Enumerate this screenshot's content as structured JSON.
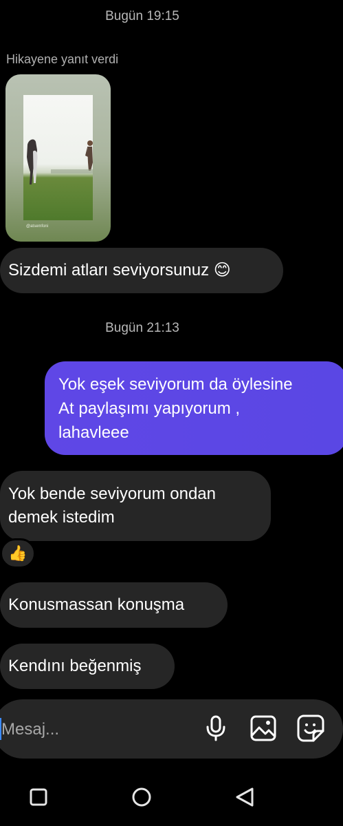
{
  "timestamps": [
    "Bugün 19:15",
    "Bugün 21:13"
  ],
  "story_reply": {
    "label": "Hikayene yanıt verdi",
    "brand_text": "@atsemfoni"
  },
  "messages": {
    "m1": "Sizdemi atları seviyorsunuz 😊",
    "sent_lines": [
      "Yok eşek seviyorum da öylesine",
      "At paylaşımı yapıyorum ,",
      "lahavleee"
    ],
    "m2_lines": [
      "Yok bende seviyorum  ondan",
      "demek istedim"
    ],
    "reaction": "👍",
    "m3": "Konusmassan konuşma",
    "m4": "Kendını beğenmiş"
  },
  "composer": {
    "placeholder": "Mesaj...",
    "icons": [
      "microphone-icon",
      "image-icon",
      "sticker-icon"
    ]
  },
  "navbar": {
    "icons": [
      "square-icon",
      "circle-icon",
      "back-triangle-icon"
    ]
  },
  "colors": {
    "background": "#000000",
    "received_bubble": "#262626",
    "sent_bubble": "#5a47e4",
    "timestamp": "#b8b8b8"
  }
}
